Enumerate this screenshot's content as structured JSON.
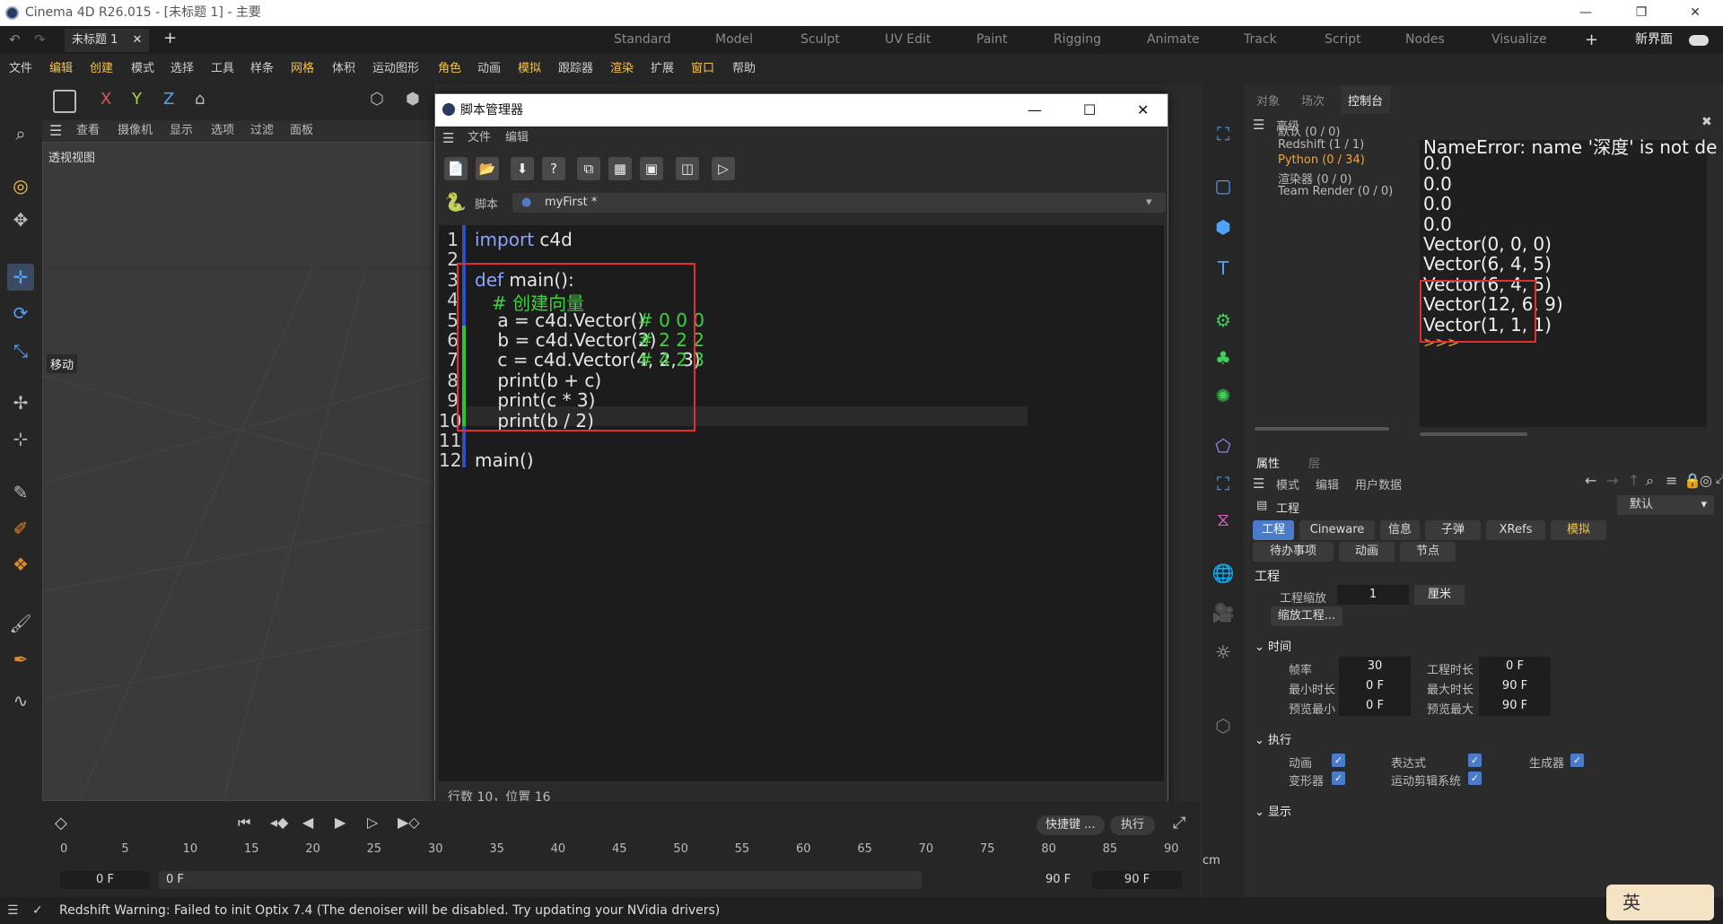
{
  "window": {
    "title": "Cinema 4D R26.015 - [未标题 1] - 主要",
    "min": "—",
    "max": "❐",
    "close": "✕"
  },
  "doc_tab": {
    "label": "未标题 1",
    "close": "✕",
    "add": "+"
  },
  "layouts": [
    "Standard",
    "Model",
    "Sculpt",
    "UV Edit",
    "Paint",
    "Rigging",
    "Animate",
    "Track",
    "Script",
    "Nodes",
    "Visualize"
  ],
  "layout_add": "+",
  "new_ui": "新界面",
  "menu": [
    "文件",
    "编辑",
    "创建",
    "模式",
    "选择",
    "工具",
    "样条",
    "网格",
    "体积",
    "运动图形",
    "角色",
    "动画",
    "模拟",
    "跟踪器",
    "渲染",
    "扩展",
    "窗口",
    "帮助"
  ],
  "axes": {
    "x": "X",
    "y": "Y",
    "z": "Z"
  },
  "viewport_menu": [
    "查看",
    "摄像机",
    "显示",
    "选项",
    "过滤",
    "面板"
  ],
  "viewport_label": "透视视图",
  "move_label": "移动",
  "cm_label": "cm",
  "script_manager": {
    "title": "脚本管理器",
    "menu": [
      "文件",
      "编辑"
    ],
    "script_label": "脚本",
    "script_name": "myFirst *",
    "status": "行数 10，位置 16",
    "shortcut_btn": "快捷键 ...",
    "run_btn": "执行",
    "line_numbers": [
      "1",
      "2",
      "3",
      "4",
      "5",
      "6",
      "7",
      "8",
      "9",
      "10",
      "11",
      "12"
    ],
    "code": [
      {
        "kw": "import",
        "rest": " c4d",
        "comment": ""
      },
      {
        "kw": "",
        "rest": "",
        "comment": ""
      },
      {
        "kw": "def",
        "rest": " main():",
        "comment": ""
      },
      {
        "kw": "",
        "rest": "    ",
        "comment": "# 创建向量"
      },
      {
        "kw": "",
        "rest": "    a = c4d.Vector()",
        "comment": "# 0 0 0"
      },
      {
        "kw": "",
        "rest": "    b = c4d.Vector(2)",
        "comment": "# 2 2 2"
      },
      {
        "kw": "",
        "rest": "    c = c4d.Vector(4, 2, 3)",
        "comment": "# 4 2 3"
      },
      {
        "kw": "",
        "rest": "    print(b + c)",
        "comment": ""
      },
      {
        "kw": "",
        "rest": "    print(c * 3)",
        "comment": ""
      },
      {
        "kw": "",
        "rest": "    print(b / 2)",
        "comment": ""
      },
      {
        "kw": "",
        "rest": "",
        "comment": ""
      },
      {
        "kw": "",
        "rest": "main()",
        "comment": ""
      }
    ]
  },
  "panel_tabs": [
    "对象",
    "场次",
    "控制台"
  ],
  "console_header": "高级",
  "console_tree": [
    "默认 (0 / 0)",
    "Redshift (1 / 1)",
    "Python (0 / 34)",
    "渲染器 (0 / 0)",
    "Team Render  (0 / 0)"
  ],
  "console_lines": [
    "NameError: name '深度' is not de",
    "0.0",
    "0.0",
    "0.0",
    "0.0",
    "Vector(0, 0, 0)",
    "Vector(6, 4, 5)",
    "Vector(6, 4, 5)",
    "Vector(12, 6, 9)",
    "Vector(1, 1, 1)",
    ">>>"
  ],
  "attr_tabs": [
    "属性",
    "层"
  ],
  "attr_menu": [
    "模式",
    "编辑",
    "用户数据"
  ],
  "project_label": "工程",
  "default_dropdown": "默认",
  "attr_pills": [
    "工程",
    "Cineware",
    "信息",
    "子弹",
    "XRefs",
    "模拟",
    "待办事项",
    "动画",
    "节点"
  ],
  "section_project": "工程",
  "project_scale_label": "工程缩放",
  "project_scale_value": "1",
  "project_scale_unit": "厘米",
  "scale_project_btn": "缩放工程...",
  "section_time": "时间",
  "time_fields": [
    {
      "label": "帧率",
      "value": "30"
    },
    {
      "label": "工程时长",
      "value": "0 F"
    },
    {
      "label": "最小时长",
      "value": "0 F"
    },
    {
      "label": "最大时长",
      "value": "90 F"
    },
    {
      "label": "预览最小",
      "value": "0 F"
    },
    {
      "label": "预览最大",
      "value": "90 F"
    }
  ],
  "section_exec": "执行",
  "exec_checks": [
    "动画",
    "表达式",
    "生成器",
    "变形器",
    "运动剪辑系统"
  ],
  "section_display": "显示",
  "timeline_ticks": [
    "0",
    "5",
    "10",
    "15",
    "20",
    "25",
    "30",
    "35",
    "40",
    "45",
    "50",
    "55",
    "60",
    "65",
    "70",
    "75",
    "80",
    "85",
    "90"
  ],
  "timeline_fields": {
    "current": "0 F",
    "start": "0 F",
    "end": "90 F",
    "max": "90 F"
  },
  "status_text": "Redshift Warning: Failed to init Optix 7.4 (The denoiser will be disabled. Try updating your NVidia drivers)",
  "ime": "英"
}
